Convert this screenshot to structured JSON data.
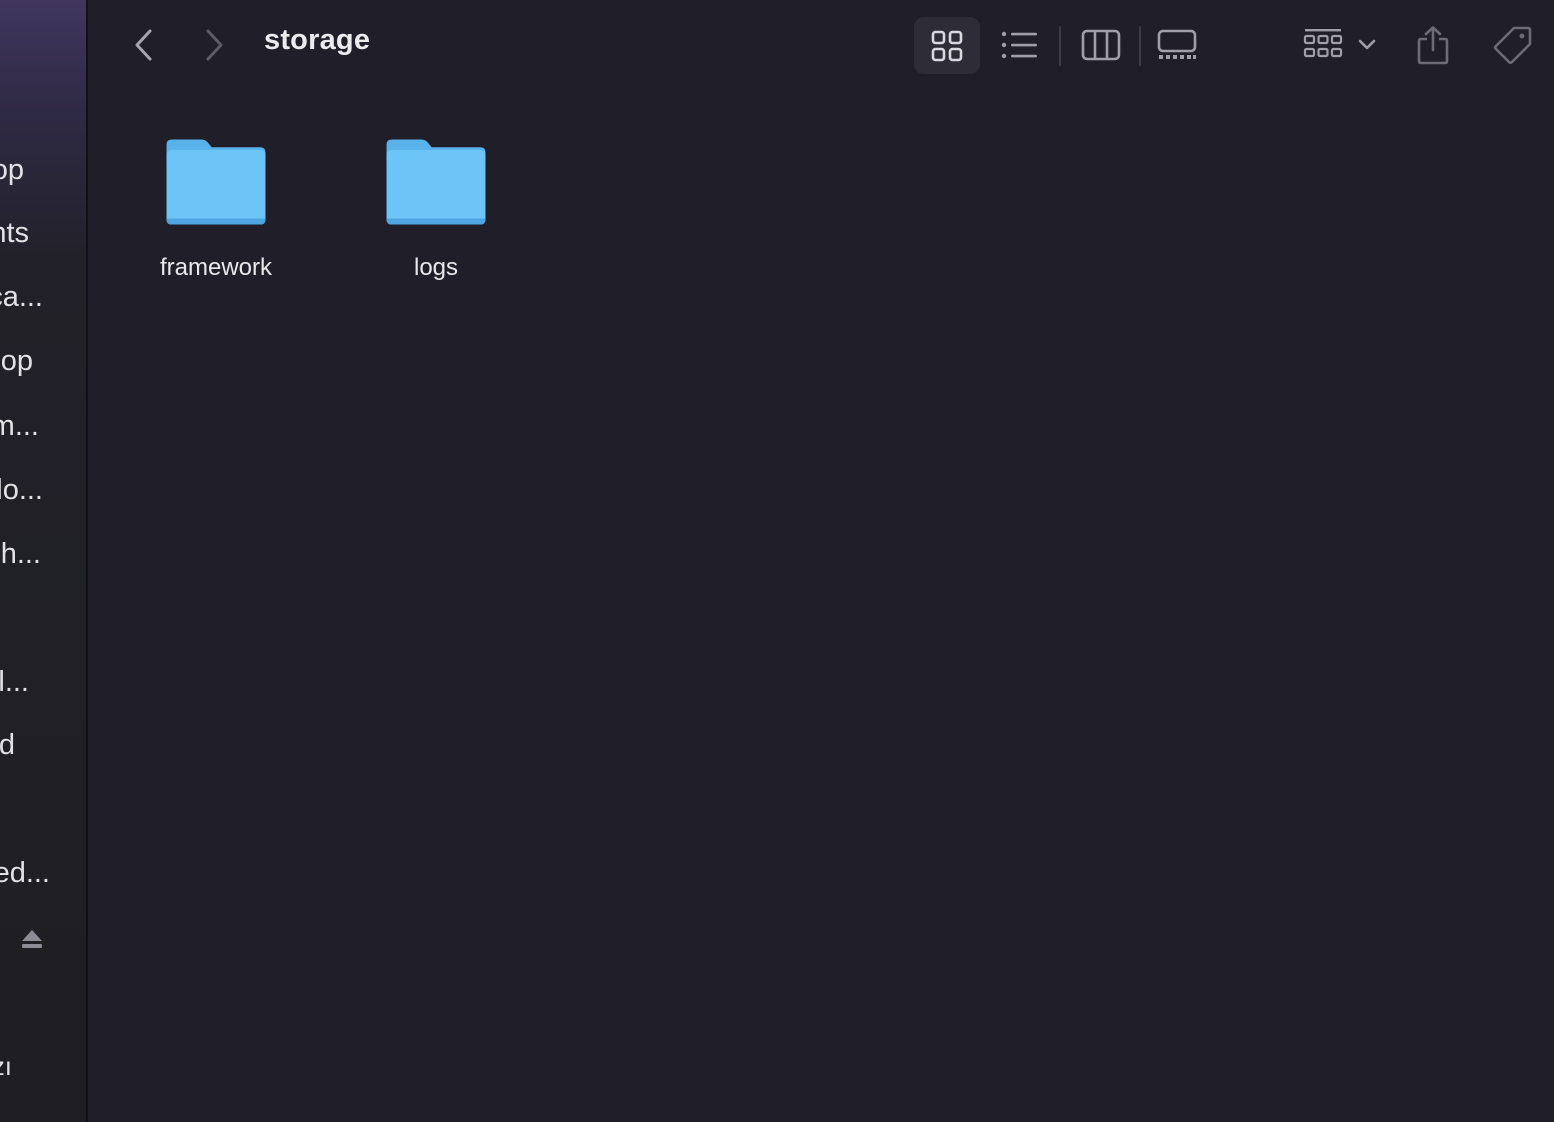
{
  "window": {
    "title": "storage"
  },
  "sidebar": {
    "items": [
      {
        "label": "op"
      },
      {
        "label": "nts"
      },
      {
        "label": "ca..."
      },
      {
        "label": "op"
      },
      {
        "label": "m..."
      },
      {
        "label": "lo..."
      },
      {
        "label": "h..."
      },
      {
        "label": "l..."
      },
      {
        "label": "d"
      },
      {
        "label": "ed..."
      },
      {
        "label": "zı"
      }
    ]
  },
  "toolbar": {
    "back_icon": "chevron-left-icon",
    "forward_icon": "chevron-right-icon",
    "views": [
      {
        "icon": "icon-view-icon",
        "active": true
      },
      {
        "icon": "list-view-icon",
        "active": false
      },
      {
        "icon": "column-view-icon",
        "active": false
      },
      {
        "icon": "gallery-view-icon",
        "active": false
      }
    ],
    "group_icon": "group-by-icon",
    "share_icon": "share-icon",
    "tag_icon": "tag-icon"
  },
  "files": [
    {
      "name": "framework",
      "type": "folder"
    },
    {
      "name": "logs",
      "type": "folder"
    }
  ],
  "colors": {
    "background": "#201f29",
    "folder": "#6cc4f7",
    "folder_tab": "#5ab2ea",
    "text": "#e8e8ec",
    "icon": "#9a99a4"
  }
}
